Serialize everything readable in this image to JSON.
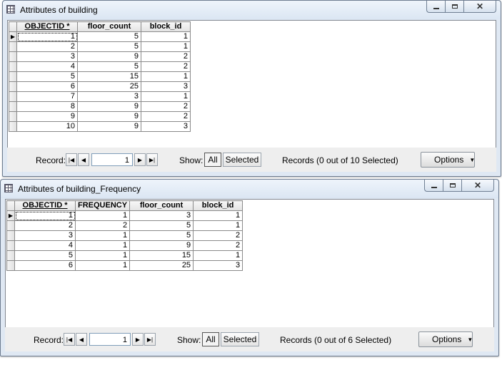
{
  "window1": {
    "title": "Attributes of building",
    "columns": [
      "OBJECTID *",
      "floor_count",
      "block_id"
    ],
    "rows": [
      [
        "1",
        "5",
        "1"
      ],
      [
        "2",
        "5",
        "1"
      ],
      [
        "3",
        "9",
        "2"
      ],
      [
        "4",
        "5",
        "2"
      ],
      [
        "5",
        "15",
        "1"
      ],
      [
        "6",
        "25",
        "3"
      ],
      [
        "7",
        "3",
        "1"
      ],
      [
        "8",
        "9",
        "2"
      ],
      [
        "9",
        "9",
        "2"
      ],
      [
        "10",
        "9",
        "3"
      ]
    ],
    "status": {
      "record_label": "Record:",
      "record_value": "1",
      "show_label": "Show:",
      "all_label": "All",
      "selected_label": "Selected",
      "records_text": "Records (0 out of 10 Selected)",
      "options_label": "Options"
    }
  },
  "window2": {
    "title": "Attributes of building_Frequency",
    "columns": [
      "OBJECTID *",
      "FREQUENCY",
      "floor_count",
      "block_id"
    ],
    "rows": [
      [
        "1",
        "1",
        "3",
        "1"
      ],
      [
        "2",
        "2",
        "5",
        "1"
      ],
      [
        "3",
        "1",
        "5",
        "2"
      ],
      [
        "4",
        "1",
        "9",
        "2"
      ],
      [
        "5",
        "1",
        "15",
        "1"
      ],
      [
        "6",
        "1",
        "25",
        "3"
      ]
    ],
    "status": {
      "record_label": "Record:",
      "record_value": "1",
      "show_label": "Show:",
      "all_label": "All",
      "selected_label": "Selected",
      "records_text": "Records (0 out of 6 Selected)",
      "options_label": "Options"
    }
  },
  "icons": {
    "current_row": "current-row-arrow-icon",
    "first": "first-record-icon",
    "prev": "previous-record-icon",
    "next": "next-record-icon",
    "last": "last-record-icon",
    "table": "table-icon",
    "dropdown": "dropdown-arrow-icon"
  },
  "colors": {
    "window_frame": "#dfe8f3",
    "client_bg": "#eeeeee",
    "grid_bg": "#ffffff"
  }
}
